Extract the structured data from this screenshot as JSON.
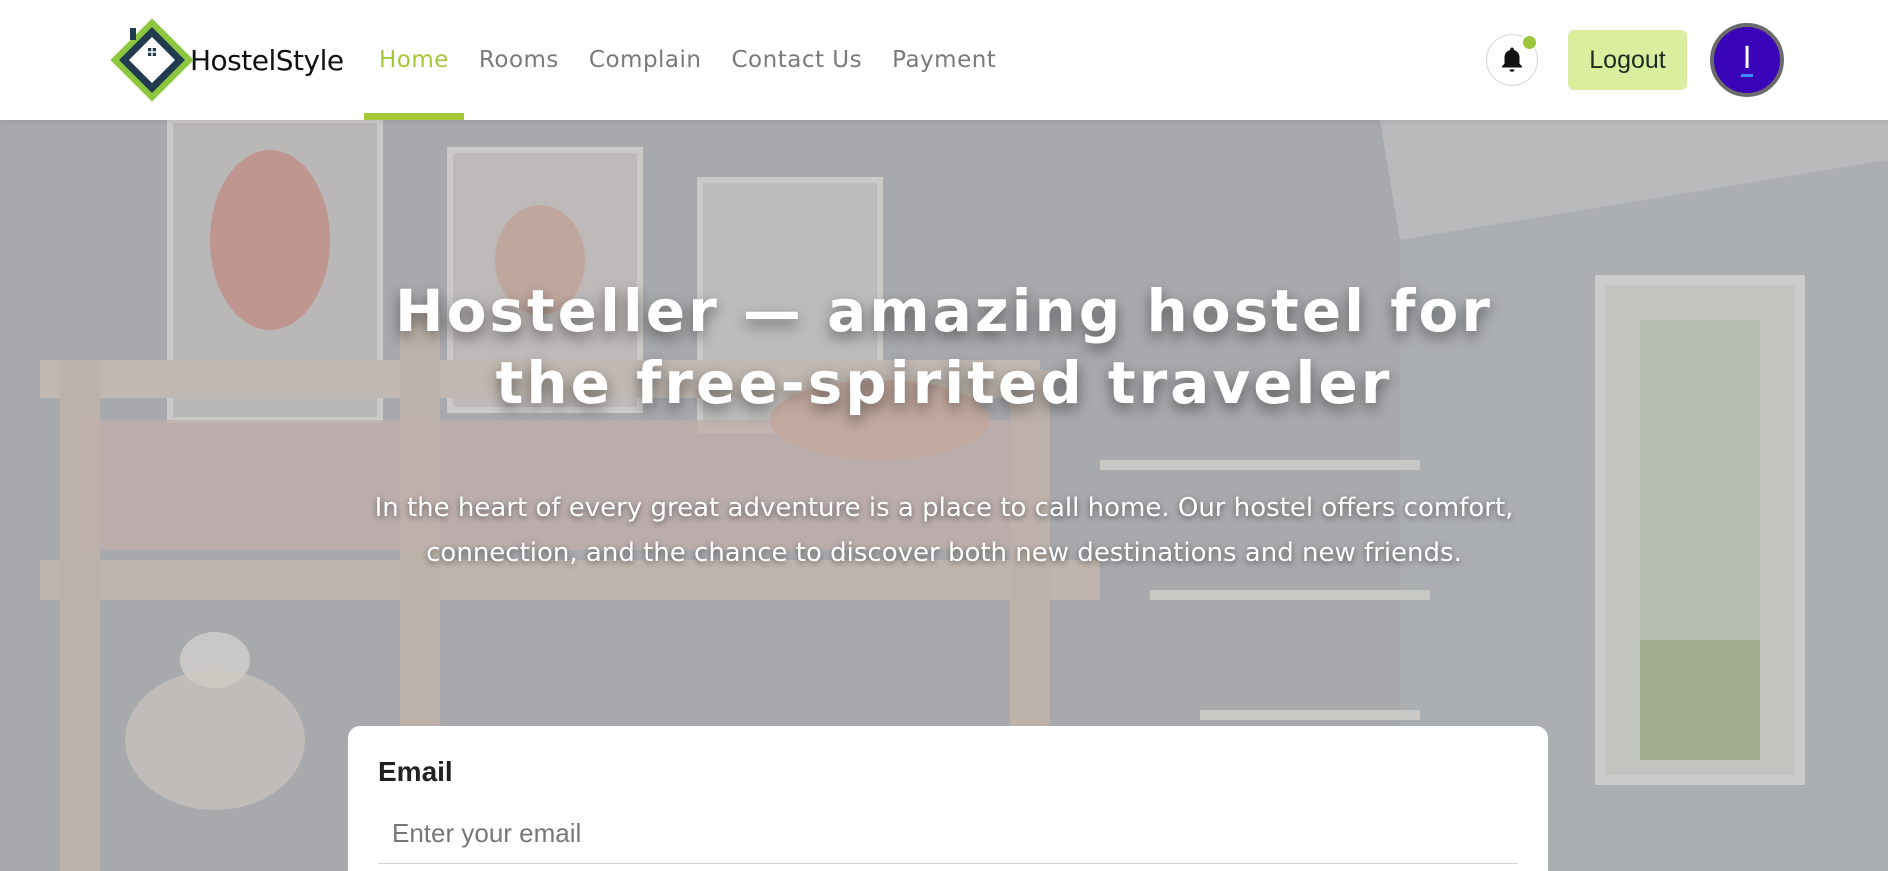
{
  "brand": {
    "name": "HostelStyle",
    "logo_icon": "house-diamond-logo"
  },
  "nav": {
    "items": [
      {
        "label": "Home",
        "active": true
      },
      {
        "label": "Rooms",
        "active": false
      },
      {
        "label": "Complain",
        "active": false
      },
      {
        "label": "Contact Us",
        "active": false
      },
      {
        "label": "Payment",
        "active": false
      }
    ]
  },
  "header_actions": {
    "notification_icon": "bell-icon",
    "has_unread": true,
    "logout_label": "Logout",
    "avatar_initial": "I"
  },
  "hero": {
    "title": "Hosteller — amazing hostel for the free-spirited traveler",
    "subtitle": "In the heart of every great adventure is a place to call home. Our hostel offers comfort, connection, and the chance to discover both new destinations and new friends."
  },
  "form": {
    "email_label": "Email",
    "email_placeholder": "Enter your email",
    "email_value": ""
  },
  "colors": {
    "accent": "#a4c639",
    "logout_bg": "#dbeea0",
    "avatar_bg": "#3a05b8",
    "logo_dark": "#1f3b4d",
    "logo_green": "#8dc63f"
  }
}
